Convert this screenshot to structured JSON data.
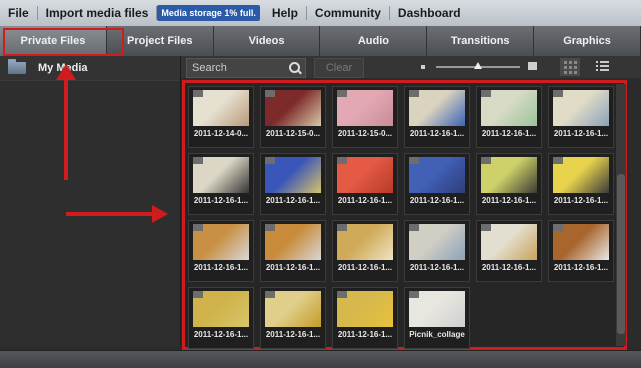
{
  "menu": {
    "items": [
      "File",
      "Import media files",
      "Help",
      "Community",
      "Dashboard"
    ],
    "storage_badge": "Media storage 1% full."
  },
  "tabs": [
    "Private Files",
    "Project Files",
    "Videos",
    "Audio",
    "Transitions",
    "Graphics"
  ],
  "sidebar": {
    "my_media": "My Media"
  },
  "toolbar": {
    "search_placeholder": "Search",
    "clear_label": "Clear"
  },
  "thumbnails": [
    {
      "label": "2011-12-14-0...",
      "colors": [
        "#e6e0d0",
        "#b79a7a"
      ]
    },
    {
      "label": "2011-12-15-0...",
      "colors": [
        "#7d2a2a",
        "#d8c8a8"
      ]
    },
    {
      "label": "2011-12-15-0...",
      "colors": [
        "#e2a9b4",
        "#c98b96"
      ]
    },
    {
      "label": "2011-12-16-1...",
      "colors": [
        "#d9d3bf",
        "#3b63b5"
      ]
    },
    {
      "label": "2011-12-16-1...",
      "colors": [
        "#d7dbc5",
        "#9ac39a"
      ]
    },
    {
      "label": "2011-12-16-1...",
      "colors": [
        "#e1dcc7",
        "#8aa0b8"
      ]
    },
    {
      "label": "2011-12-16-1...",
      "colors": [
        "#dcd7c4",
        "#343434"
      ]
    },
    {
      "label": "2011-12-16-1...",
      "colors": [
        "#3a56b8",
        "#d7c26a"
      ]
    },
    {
      "label": "2011-12-16-1...",
      "colors": [
        "#e45a44",
        "#b73a2a"
      ]
    },
    {
      "label": "2011-12-16-1...",
      "colors": [
        "#4260b6",
        "#2d3f7a"
      ]
    },
    {
      "label": "2011-12-16-1...",
      "colors": [
        "#ced16a",
        "#3b3a33"
      ]
    },
    {
      "label": "2011-12-16-1...",
      "colors": [
        "#e8d34c",
        "#3a3a3a"
      ]
    },
    {
      "label": "2011-12-16-1...",
      "colors": [
        "#c79044",
        "#d8d8d8"
      ]
    },
    {
      "label": "2011-12-16-1...",
      "colors": [
        "#c98c3c",
        "#d7d7d7"
      ]
    },
    {
      "label": "2011-12-16-1...",
      "colors": [
        "#cfaa58",
        "#efe3c3"
      ]
    },
    {
      "label": "2011-12-16-1...",
      "colors": [
        "#d1cfc4",
        "#8aa2b9"
      ]
    },
    {
      "label": "2011-12-16-1...",
      "colors": [
        "#e3dfd0",
        "#c9a35a"
      ]
    },
    {
      "label": "2011-12-16-1...",
      "colors": [
        "#a8652c",
        "#e8e8e8"
      ]
    },
    {
      "label": "2011-12-16-1...",
      "colors": [
        "#cfb24a",
        "#d8c66a"
      ]
    },
    {
      "label": "2011-12-16-1...",
      "colors": [
        "#e0cf8a",
        "#c49a2a"
      ]
    },
    {
      "label": "2011-12-16-1...",
      "colors": [
        "#d6b84c",
        "#e8c13a"
      ]
    },
    {
      "label": "Picnik_collage",
      "colors": [
        "#e7e6df",
        "#cfcfcf"
      ]
    }
  ],
  "colors": {
    "annotation": "#d01c1c",
    "storage_badge": "#2b5aa8"
  }
}
